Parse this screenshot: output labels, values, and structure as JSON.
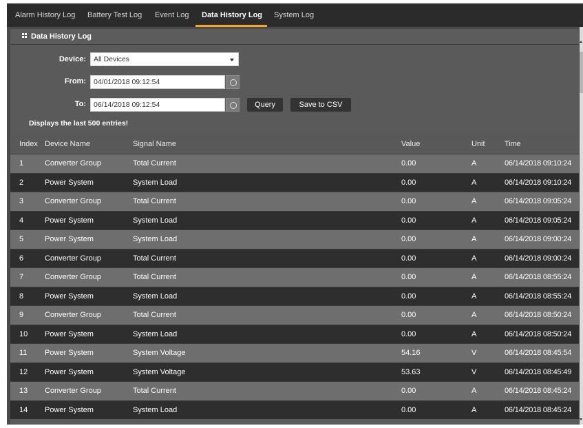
{
  "tabs": [
    {
      "label": "Alarm History Log"
    },
    {
      "label": "Battery Test Log"
    },
    {
      "label": "Event Log"
    },
    {
      "label": "Data History Log"
    },
    {
      "label": "System Log"
    }
  ],
  "active_tab": "Data History Log",
  "colors": {
    "accent": "#f5a623",
    "tabbar": "#2b2b2b",
    "row_light": "#6e6e6e",
    "row_dark": "#2e2e2e"
  },
  "panel": {
    "title": "Data History Log",
    "icon": "grid-icon"
  },
  "form": {
    "device_label": "Device:",
    "device_value": "All Devices",
    "from_label": "From:",
    "from_value": "04/01/2018 09:12:54",
    "to_label": "To:",
    "to_value": "06/14/2018 09:12:54",
    "query_label": "Query",
    "save_label": "Save to CSV",
    "notice": "Displays the last 500 entries!"
  },
  "table": {
    "headers": {
      "index": "Index",
      "device": "Device Name",
      "signal": "Signal Name",
      "value": "Value",
      "unit": "Unit",
      "time": "Time"
    },
    "rows": [
      {
        "index": "1",
        "device": "Converter Group",
        "signal": "Total Current",
        "value": "0.00",
        "unit": "A",
        "time": "06/14/2018 09:10:24"
      },
      {
        "index": "2",
        "device": "Power System",
        "signal": "System Load",
        "value": "0.00",
        "unit": "A",
        "time": "06/14/2018 09:10:24"
      },
      {
        "index": "3",
        "device": "Converter Group",
        "signal": "Total Current",
        "value": "0.00",
        "unit": "A",
        "time": "06/14/2018 09:05:24"
      },
      {
        "index": "4",
        "device": "Power System",
        "signal": "System Load",
        "value": "0.00",
        "unit": "A",
        "time": "06/14/2018 09:05:24"
      },
      {
        "index": "5",
        "device": "Power System",
        "signal": "System Load",
        "value": "0.00",
        "unit": "A",
        "time": "06/14/2018 09:00:24"
      },
      {
        "index": "6",
        "device": "Converter Group",
        "signal": "Total Current",
        "value": "0.00",
        "unit": "A",
        "time": "06/14/2018 09:00:24"
      },
      {
        "index": "7",
        "device": "Converter Group",
        "signal": "Total Current",
        "value": "0.00",
        "unit": "A",
        "time": "06/14/2018 08:55:24"
      },
      {
        "index": "8",
        "device": "Power System",
        "signal": "System Load",
        "value": "0.00",
        "unit": "A",
        "time": "06/14/2018 08:55:24"
      },
      {
        "index": "9",
        "device": "Converter Group",
        "signal": "Total Current",
        "value": "0.00",
        "unit": "A",
        "time": "06/14/2018 08:50:24"
      },
      {
        "index": "10",
        "device": "Power System",
        "signal": "System Load",
        "value": "0.00",
        "unit": "A",
        "time": "06/14/2018 08:50:24"
      },
      {
        "index": "11",
        "device": "Power System",
        "signal": "System Voltage",
        "value": "54.16",
        "unit": "V",
        "time": "06/14/2018 08:45:54"
      },
      {
        "index": "12",
        "device": "Power System",
        "signal": "System Voltage",
        "value": "53.63",
        "unit": "V",
        "time": "06/14/2018 08:45:49"
      },
      {
        "index": "13",
        "device": "Converter Group",
        "signal": "Total Current",
        "value": "0.00",
        "unit": "A",
        "time": "06/14/2018 08:45:24"
      },
      {
        "index": "14",
        "device": "Power System",
        "signal": "System Load",
        "value": "0.00",
        "unit": "A",
        "time": "06/14/2018 08:45:24"
      }
    ]
  }
}
